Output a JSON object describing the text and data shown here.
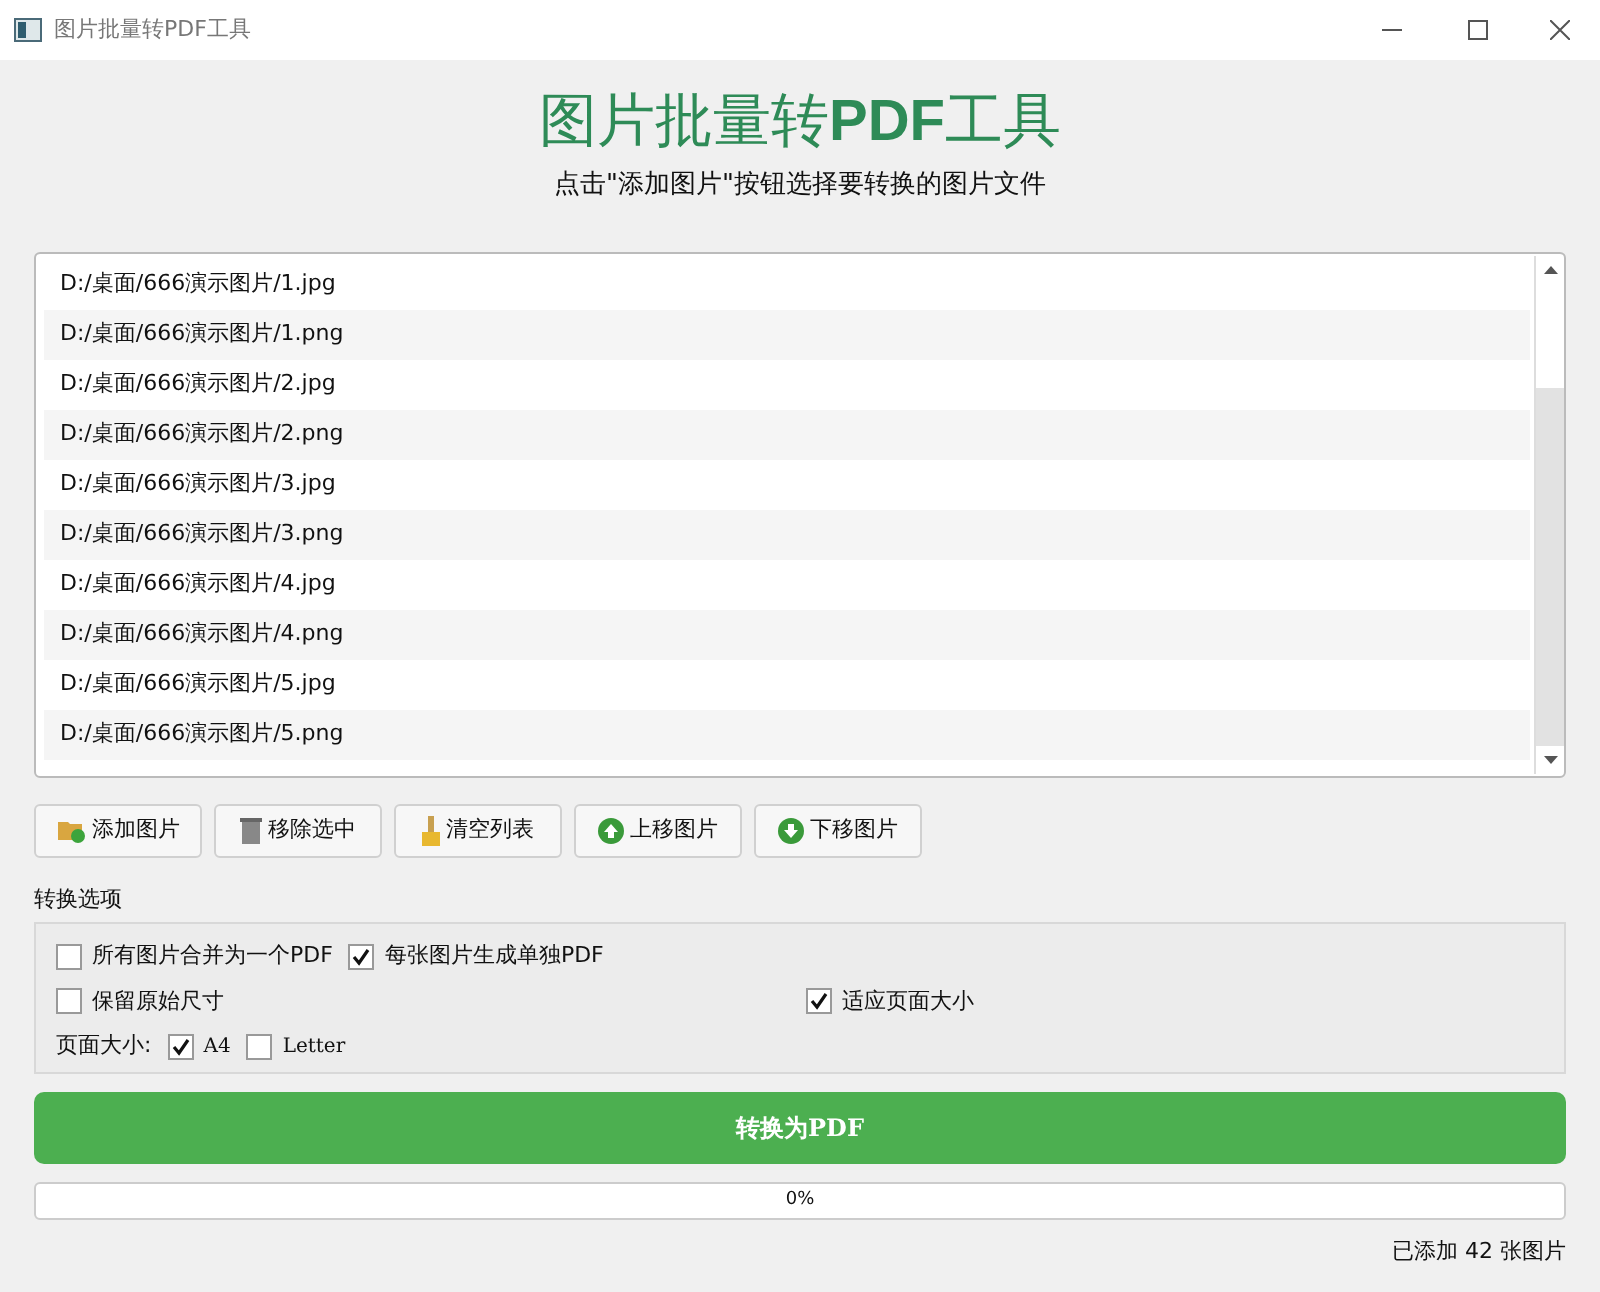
{
  "window": {
    "title": "图片批量转PDF工具"
  },
  "heading": {
    "title_parts": [
      "图片批量转",
      "PDF",
      "工具"
    ],
    "subtitle": "点击\"添加图片\"按钮选择要转换的图片文件"
  },
  "file_list": [
    {
      "path": "D:/桌面/666演示图片/1.jpg"
    },
    {
      "path": "D:/桌面/666演示图片/1.png"
    },
    {
      "path": "D:/桌面/666演示图片/2.jpg"
    },
    {
      "path": "D:/桌面/666演示图片/2.png"
    },
    {
      "path": "D:/桌面/666演示图片/3.jpg"
    },
    {
      "path": "D:/桌面/666演示图片/3.png"
    },
    {
      "path": "D:/桌面/666演示图片/4.jpg"
    },
    {
      "path": "D:/桌面/666演示图片/4.png"
    },
    {
      "path": "D:/桌面/666演示图片/5.jpg"
    },
    {
      "path": "D:/桌面/666演示图片/5.png"
    }
  ],
  "toolbar": [
    {
      "kind": "add",
      "label": "添加图片"
    },
    {
      "kind": "remove",
      "label": "移除选中"
    },
    {
      "kind": "clear",
      "label": "清空列表"
    },
    {
      "kind": "up",
      "label": "上移图片"
    },
    {
      "kind": "down",
      "label": "下移图片"
    }
  ],
  "options": {
    "title": "转换选项",
    "merge": {
      "label": "所有图片合并为一个PDF",
      "checked": false
    },
    "separate": {
      "label": "每张图片生成单独PDF",
      "checked": true
    },
    "keep_size": {
      "label": "保留原始尺寸",
      "checked": false
    },
    "fit_page": {
      "label": "适应页面大小",
      "checked": true
    },
    "page_size_label": "页面大小:",
    "page_sizes": [
      {
        "label": "A4",
        "checked": true
      },
      {
        "label": "Letter",
        "checked": false
      }
    ]
  },
  "convert_button": "转换为PDF",
  "progress": {
    "level": 0,
    "reading": "0%"
  },
  "status": "已添加 42 张图片"
}
